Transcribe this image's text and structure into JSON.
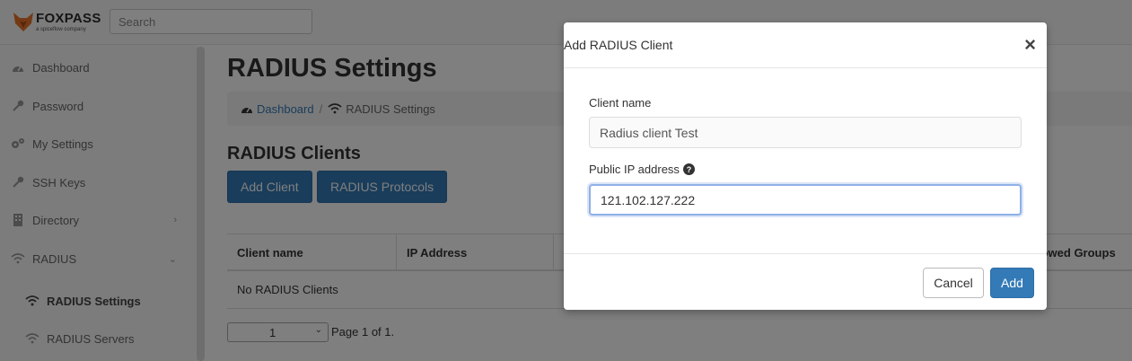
{
  "brand": {
    "name": "FOXPASS",
    "sub": "a spiceflow company"
  },
  "search": {
    "placeholder": "Search"
  },
  "sidebar": {
    "items": [
      {
        "label": "Dashboard",
        "icon": "dashboard-icon"
      },
      {
        "label": "Password",
        "icon": "key-icon"
      },
      {
        "label": "My Settings",
        "icon": "gears-icon"
      },
      {
        "label": "SSH Keys",
        "icon": "key-icon"
      },
      {
        "label": "Directory",
        "icon": "building-icon",
        "chevron": "›"
      },
      {
        "label": "RADIUS",
        "icon": "wifi-icon",
        "chevron": "⌄"
      },
      {
        "label": "RADIUS Settings",
        "icon": "wifi-icon"
      },
      {
        "label": "RADIUS Servers",
        "icon": "wifi-icon"
      }
    ]
  },
  "main": {
    "title": "RADIUS Settings",
    "breadcrumb": {
      "home": "Dashboard",
      "separator": "/",
      "current": "RADIUS Settings"
    },
    "section_title": "RADIUS Clients",
    "buttons": {
      "add_client": "Add Client",
      "protocols": "RADIUS Protocols"
    },
    "table": {
      "columns": [
        "Client name",
        "IP Address",
        "Allowed Groups"
      ],
      "empty_text": "No RADIUS Clients"
    },
    "pager": {
      "selected": "1",
      "text": "Page 1 of 1."
    }
  },
  "modal": {
    "title": "Add RADIUS Client",
    "close": "×",
    "client_name_label": "Client name",
    "client_name_value": "Radius client Test",
    "ip_label": "Public IP address",
    "ip_help": "?",
    "ip_value": "121.102.127.222",
    "cancel": "Cancel",
    "add": "Add"
  },
  "colors": {
    "primary": "#337ab7",
    "brand_orange": "#e8742a"
  }
}
